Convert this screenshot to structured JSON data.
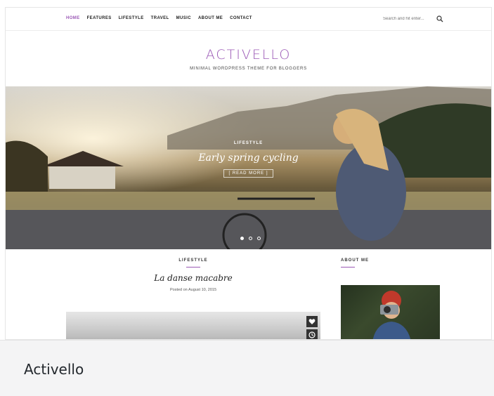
{
  "nav": {
    "items": [
      {
        "label": "HOME",
        "active": true
      },
      {
        "label": "FEATURES",
        "active": false
      },
      {
        "label": "LIFESTYLE",
        "active": false
      },
      {
        "label": "TRAVEL",
        "active": false
      },
      {
        "label": "MUSIC",
        "active": false
      },
      {
        "label": "ABOUT ME",
        "active": false
      },
      {
        "label": "CONTACT",
        "active": false
      }
    ],
    "search_placeholder": "Search and hit enter...",
    "search_icon": "magnifier-icon"
  },
  "brand": {
    "title": "ACTIVELLO",
    "tagline": "MINIMAL WORDPRESS THEME FOR BLOGGERS"
  },
  "hero": {
    "category": "LIFESTYLE",
    "title": "Early spring cycling",
    "button_label": "[ READ MORE ]",
    "slides_count": 3,
    "active_slide": 1
  },
  "post": {
    "category": "LIFESTYLE",
    "title": "La danse macabre",
    "meta": "Posted on August 10, 2015",
    "actions": [
      "heart-icon",
      "clock-icon"
    ]
  },
  "sidebar": {
    "widget_title": "ABOUT ME"
  },
  "footer_caption": {
    "title": "Activello"
  },
  "colors": {
    "accent": "#9b59b6",
    "text": "#222222",
    "caption_bg": "#f4f4f5"
  }
}
